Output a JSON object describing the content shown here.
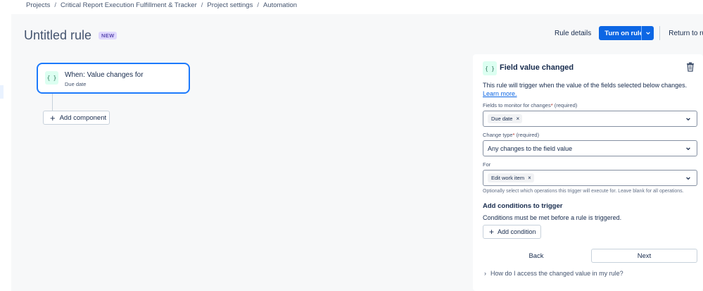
{
  "breadcrumb": [
    {
      "label": "Projects"
    },
    {
      "label": "Critical Report Execution Fulfillment & Tracker"
    },
    {
      "label": "Project settings"
    },
    {
      "label": "Automation"
    }
  ],
  "breadcrumb_separator": "/",
  "rule": {
    "title": "Untitled rule",
    "badge": "NEW"
  },
  "header_actions": {
    "rule_details": "Rule details",
    "turn_on": "Turn on rule",
    "return_to_rules": "Return to rules"
  },
  "canvas": {
    "trigger_icon_text": "{ }",
    "trigger_title": "When: Value changes for",
    "trigger_subtitle": "Due date",
    "add_component": "Add component",
    "plus_glyph": "+"
  },
  "panel": {
    "icon_text": "{ }",
    "title": "Field value changed",
    "description": "This rule will trigger when the value of the fields selected below changes.",
    "learn_more": "Learn more.",
    "fields_label": "Fields to monitor for changes",
    "required_mark": "*",
    "required_text": "(required)",
    "fields_chip": "Due date",
    "chip_remove": "×",
    "change_type_label": "Change type",
    "change_type_value": "Any changes to the field value",
    "for_label": "For",
    "for_chip": "Edit work item",
    "for_hint": "Optionally select which operations this trigger will execute for. Leave blank for all operations.",
    "conditions_title": "Add conditions to trigger",
    "conditions_desc": "Conditions must be met before a rule is triggered.",
    "add_condition": "Add condition",
    "back": "Back",
    "next": "Next",
    "faq": "How do I access the changed value in my rule?",
    "faq_chevron": "›"
  },
  "colors": {
    "primary": "#0c66e4",
    "trigger_border": "#1d7afc",
    "badge_bg": "#dfd8fd",
    "badge_text": "#5e4db2",
    "icon_bg": "#dcfff1",
    "canvas_bg": "#f7f8f9"
  },
  "icons": {
    "trigger": "code-braces-icon",
    "delete": "trash-icon",
    "dropdown": "chevron-down-icon",
    "faq": "chevron-right-icon"
  }
}
